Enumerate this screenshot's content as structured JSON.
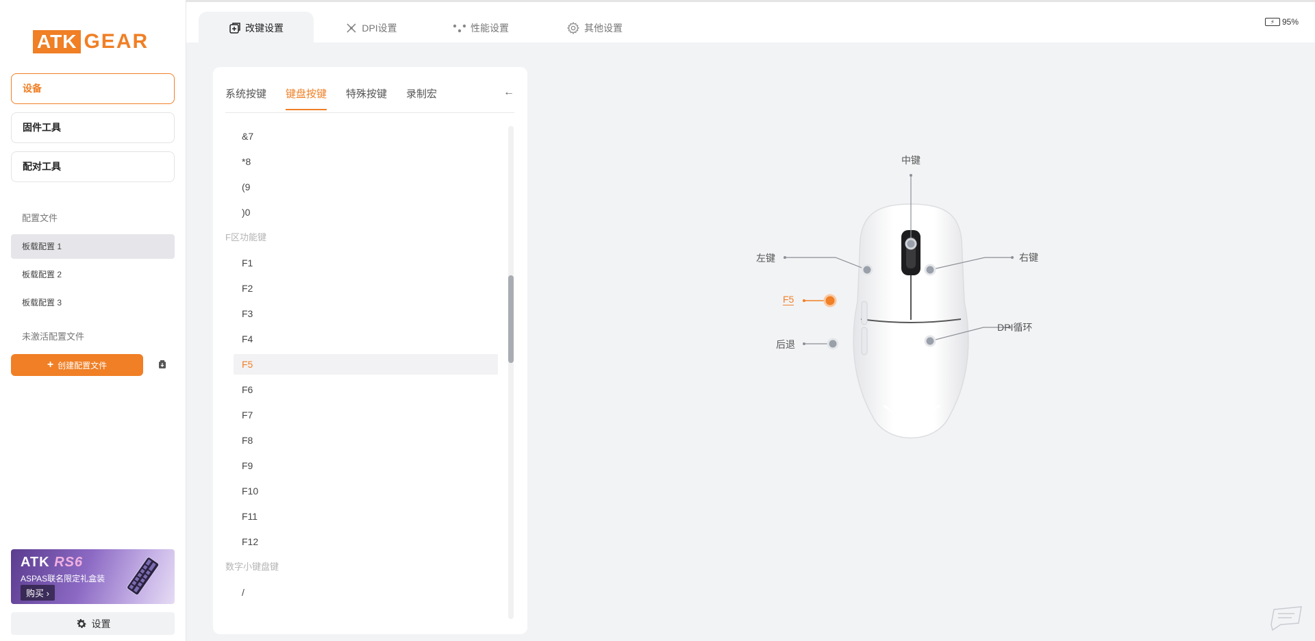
{
  "sidebar": {
    "logo": {
      "box": "ATK",
      "text": "GEAR"
    },
    "nav": [
      {
        "label": "设备",
        "active": true
      },
      {
        "label": "固件工具",
        "active": false
      },
      {
        "label": "配对工具",
        "active": false
      }
    ],
    "profiles_label": "配置文件",
    "profiles": [
      {
        "label": "板载配置 1",
        "active": true
      },
      {
        "label": "板载配置 2",
        "active": false
      },
      {
        "label": "板载配置 3",
        "active": false
      }
    ],
    "inactive_label": "未激活配置文件",
    "create_label": "创建配置文件",
    "banner": {
      "brand": "ATK",
      "model": "RS6",
      "subtitle": "ASPAS联名限定礼盒装",
      "buy": "购买 ›"
    },
    "settings_label": "设置"
  },
  "tabs": [
    {
      "label": "改键设置",
      "icon": "remap-icon",
      "active": true
    },
    {
      "label": "DPI设置",
      "icon": "dpi-icon",
      "active": false
    },
    {
      "label": "性能设置",
      "icon": "performance-icon",
      "active": false
    },
    {
      "label": "其他设置",
      "icon": "gear-icon",
      "active": false
    }
  ],
  "battery": {
    "value": "95%",
    "level": 0.95
  },
  "subtabs": [
    {
      "label": "系统按键",
      "active": false
    },
    {
      "label": "键盘按键",
      "active": true
    },
    {
      "label": "特殊按键",
      "active": false
    },
    {
      "label": "录制宏",
      "active": false
    }
  ],
  "key_list": [
    {
      "type": "key",
      "label": "&7"
    },
    {
      "type": "key",
      "label": "*8"
    },
    {
      "type": "key",
      "label": "(9"
    },
    {
      "type": "key",
      "label": ")0"
    },
    {
      "type": "group",
      "label": "F区功能键"
    },
    {
      "type": "key",
      "label": "F1"
    },
    {
      "type": "key",
      "label": "F2"
    },
    {
      "type": "key",
      "label": "F3"
    },
    {
      "type": "key",
      "label": "F4"
    },
    {
      "type": "key",
      "label": "F5",
      "selected": true
    },
    {
      "type": "key",
      "label": "F6"
    },
    {
      "type": "key",
      "label": "F7"
    },
    {
      "type": "key",
      "label": "F8"
    },
    {
      "type": "key",
      "label": "F9"
    },
    {
      "type": "key",
      "label": "F10"
    },
    {
      "type": "key",
      "label": "F11"
    },
    {
      "type": "key",
      "label": "F12"
    },
    {
      "type": "group",
      "label": "数字小键盘键"
    },
    {
      "type": "key",
      "label": "/"
    }
  ],
  "mouse_buttons": {
    "middle": "中键",
    "left": "左键",
    "right": "右键",
    "side_front": "F5",
    "back": "后退",
    "dpi": "DPI循环"
  },
  "colors": {
    "accent": "#f07f25",
    "text": "#333333",
    "muted": "#b4b4b4",
    "bg": "#f2f3f5"
  }
}
